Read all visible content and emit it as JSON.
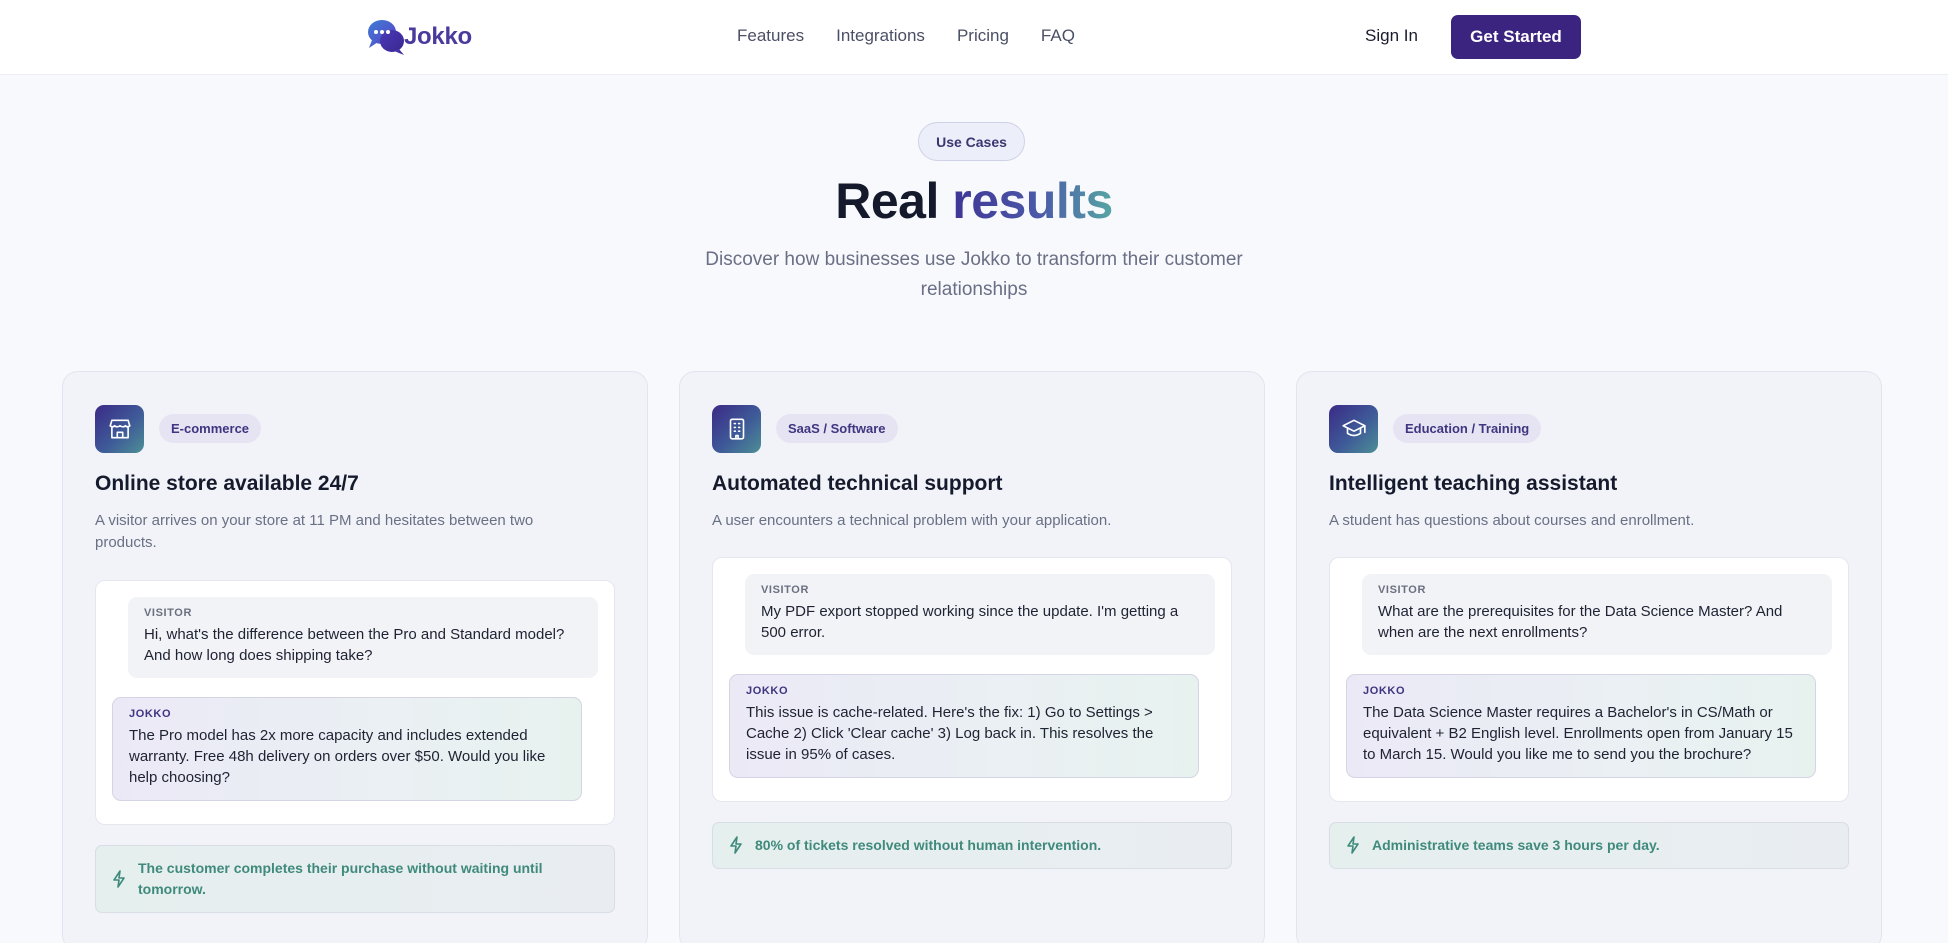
{
  "nav": {
    "brand": "Jokko",
    "links": [
      "Features",
      "Integrations",
      "Pricing",
      "FAQ"
    ],
    "sign_in": "Sign In",
    "cta": "Get Started"
  },
  "hero": {
    "badge": "Use Cases",
    "title_plain": "Real",
    "title_accent": "results",
    "subtitle": "Discover how businesses use Jokko to transform their customer relationships"
  },
  "colors": {
    "brand": "#3b2380",
    "accent_teal": "#3f8a7c"
  },
  "cards": [
    {
      "icon": "store-icon",
      "tag": "E-commerce",
      "title": "Online store available 24/7",
      "description": "A visitor arrives on your store at 11 PM and hesitates between two products.",
      "visitor_label": "VISITOR",
      "visitor_msg": "Hi, what's the difference between the Pro and Standard model? And how long does shipping take?",
      "jokko_label": "JOKKO",
      "jokko_msg": "The Pro model has 2x more capacity and includes extended warranty. Free 48h delivery on orders over $50. Would you like help choosing?",
      "result": "The customer completes their purchase without waiting until tomorrow."
    },
    {
      "icon": "building-icon",
      "tag": "SaaS / Software",
      "title": "Automated technical support",
      "description": "A user encounters a technical problem with your application.",
      "visitor_label": "VISITOR",
      "visitor_msg": "My PDF export stopped working since the update. I'm getting a 500 error.",
      "jokko_label": "JOKKO",
      "jokko_msg": "This issue is cache-related. Here's the fix: 1) Go to Settings > Cache 2) Click 'Clear cache' 3) Log back in. This resolves the issue in 95% of cases.",
      "result": "80% of tickets resolved without human intervention."
    },
    {
      "icon": "graduation-cap-icon",
      "tag": "Education / Training",
      "title": "Intelligent teaching assistant",
      "description": "A student has questions about courses and enrollment.",
      "visitor_label": "VISITOR",
      "visitor_msg": "What are the prerequisites for the Data Science Master? And when are the next enrollments?",
      "jokko_label": "JOKKO",
      "jokko_msg": "The Data Science Master requires a Bachelor's in CS/Math or equivalent + B2 English level. Enrollments open from January 15 to March 15. Would you like me to send you the brochure?",
      "result": "Administrative teams save 3 hours per day."
    }
  ]
}
